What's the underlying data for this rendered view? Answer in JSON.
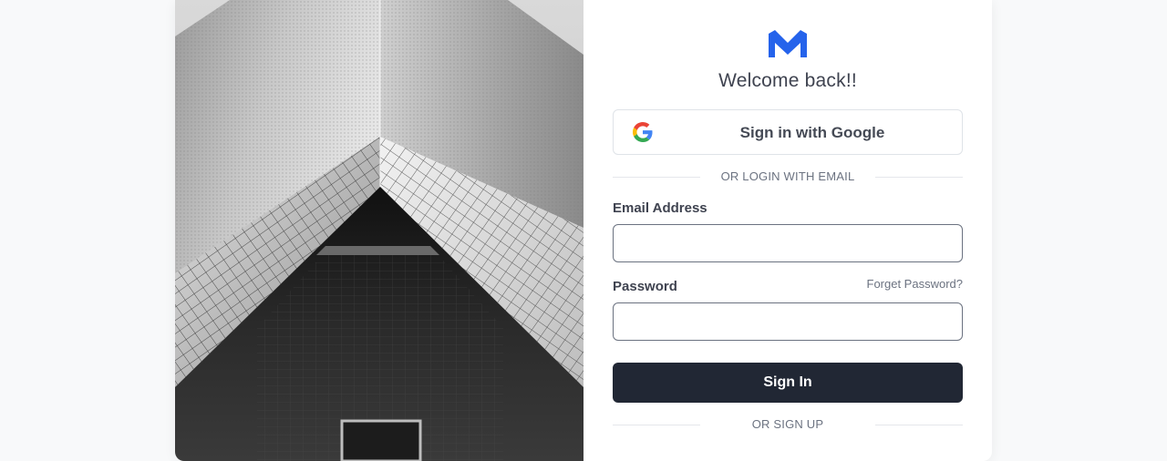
{
  "brand": {
    "logo_icon": "m-logo-icon",
    "accent_color": "#2563eb"
  },
  "header": {
    "welcome": "Welcome back!!"
  },
  "google": {
    "label": "Sign in with Google",
    "icon": "google-g-icon"
  },
  "divider_email": {
    "label": "OR LOGIN WITH EMAIL"
  },
  "email": {
    "label": "Email Address",
    "value": "",
    "placeholder": ""
  },
  "password": {
    "label": "Password",
    "value": "",
    "placeholder": "",
    "forget_label": "Forget Password?"
  },
  "signin": {
    "label": "Sign In",
    "color": "#212734"
  },
  "divider_signup": {
    "label": "OR SIGN UP"
  },
  "hero_image": {
    "subject": "building-facade-photo"
  }
}
